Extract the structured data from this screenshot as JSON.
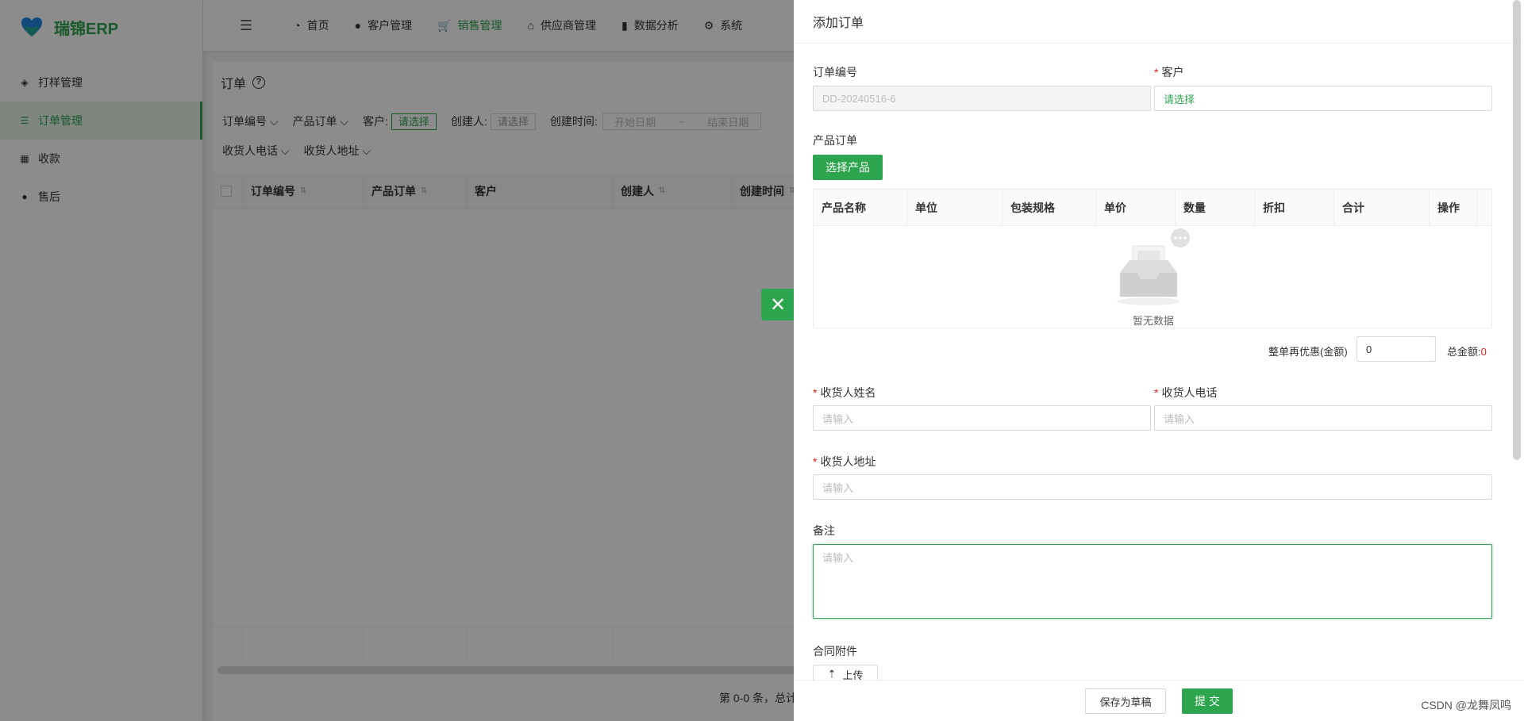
{
  "app": {
    "name": "瑞锦ERP"
  },
  "sidebar": {
    "items": [
      {
        "label": "打样管理",
        "icon": "cube-icon"
      },
      {
        "label": "订单管理",
        "icon": "list-icon"
      },
      {
        "label": "收款",
        "icon": "calculator-icon"
      },
      {
        "label": "售后",
        "icon": "user-icon"
      }
    ]
  },
  "topnav": {
    "items": [
      {
        "label": "首页",
        "icon": "dashboard-icon"
      },
      {
        "label": "客户管理",
        "icon": "user-icon"
      },
      {
        "label": "销售管理",
        "icon": "cart-icon"
      },
      {
        "label": "供应商管理",
        "icon": "bank-icon"
      },
      {
        "label": "数据分析",
        "icon": "chart-icon"
      },
      {
        "label": "系统",
        "icon": "gear-icon"
      }
    ]
  },
  "page": {
    "title": "订单",
    "filters": {
      "order_no": "订单编号",
      "product_order": "产品订单",
      "customer_label": "客户:",
      "customer_value": "请选择",
      "creator_label": "创建人:",
      "creator_value": "请选择",
      "created_label": "创建时间:",
      "start_date": "开始日期",
      "tilde": "~",
      "end_date": "结束日期",
      "phone": "收货人电话",
      "address": "收货人地址"
    },
    "table_headers": [
      "订单编号",
      "产品订单",
      "客户",
      "创建人",
      "创建时间"
    ],
    "pager": "第 0-0 条，总计"
  },
  "drawer": {
    "title": "添加订单",
    "order_no_label": "订单编号",
    "order_no_value": "DD-20240516-6",
    "customer_label": "客户",
    "customer_value": "请选择",
    "product_order_label": "产品订单",
    "select_product_button": "选择产品",
    "product_table_headers": [
      "产品名称",
      "单位",
      "包装规格",
      "单价",
      "数量",
      "折扣",
      "合计",
      "操作"
    ],
    "empty_text": "暂无数据",
    "discount_label": "整单再优惠(金额)",
    "discount_value": "0",
    "total_label": "总金额:",
    "total_value": "0",
    "receiver_name_label": "收货人姓名",
    "receiver_name_placeholder": "请输入",
    "receiver_phone_label": "收货人电话",
    "receiver_phone_placeholder": "请输入",
    "receiver_address_label": "收货人地址",
    "receiver_address_placeholder": "请输入",
    "remark_label": "备注",
    "remark_placeholder": "请输入",
    "attachment_label": "合同附件",
    "upload_button": "上传",
    "save_draft_button": "保存为草稿",
    "submit_button": "提 交"
  },
  "watermark": "CSDN @龙舞凤鸣",
  "colors": {
    "accent": "#2da44e",
    "required": "#e02020"
  }
}
